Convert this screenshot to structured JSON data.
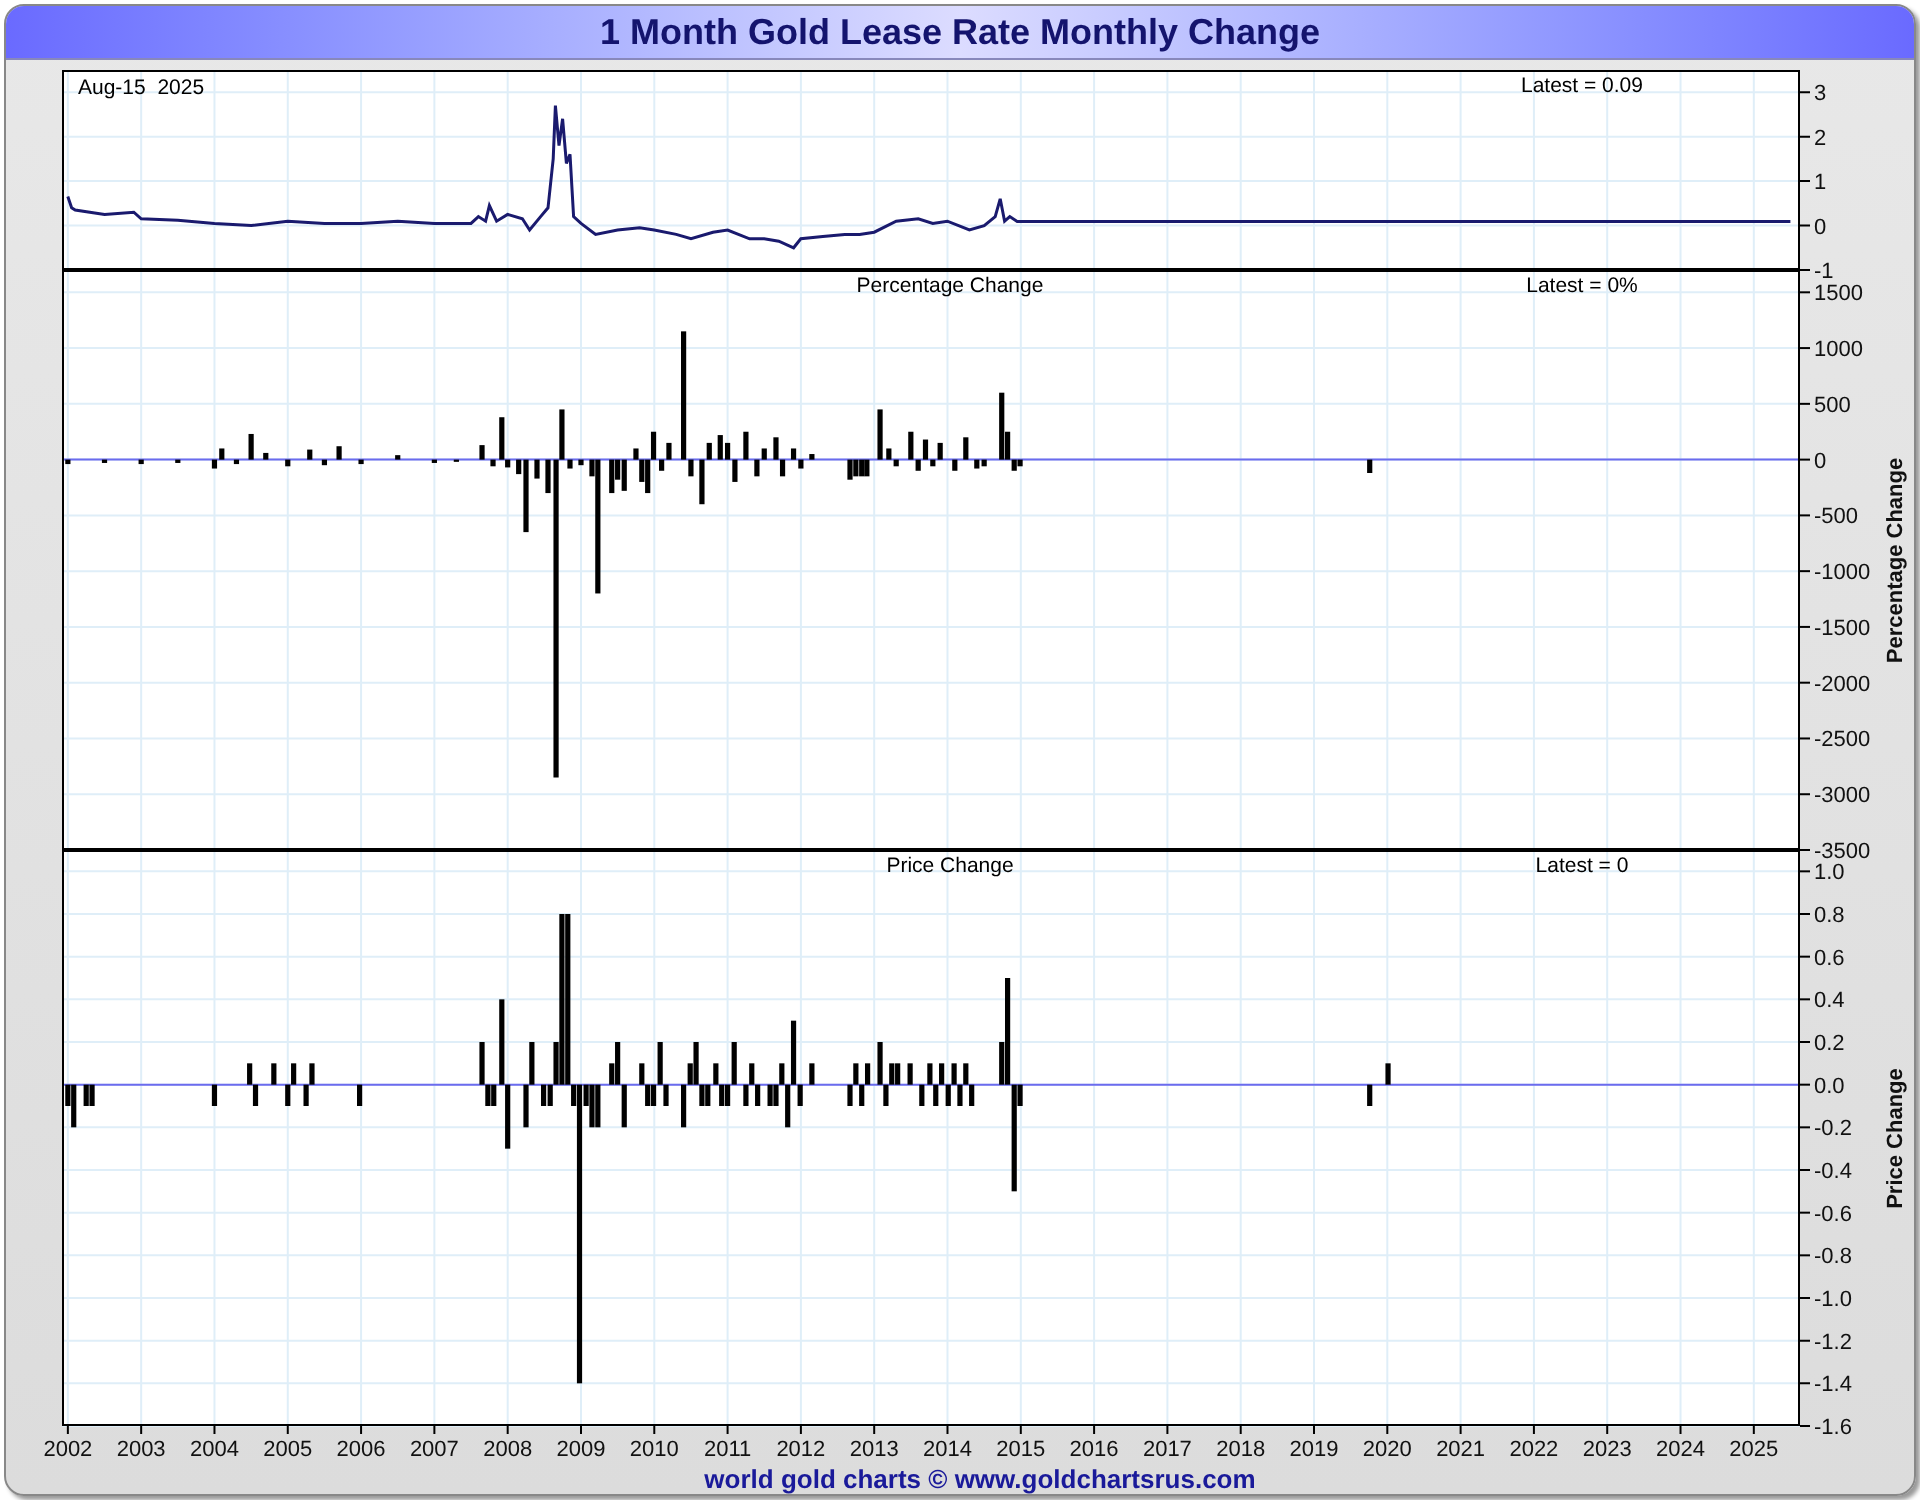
{
  "title": "1 Month Gold Lease Rate Monthly Change",
  "panels": [
    {
      "date_label": "Aug-15  2025",
      "latest": "Latest = 0.09",
      "chart_data": {
        "type": "line",
        "x": [
          2002.0,
          2002.05,
          2002.1,
          2002.3,
          2002.5,
          2002.9,
          2003.0,
          2003.5,
          2004.0,
          2004.5,
          2005.0,
          2005.5,
          2006.0,
          2006.5,
          2007.0,
          2007.5,
          2007.6,
          2007.7,
          2007.75,
          2007.85,
          2008.0,
          2008.2,
          2008.3,
          2008.45,
          2008.55,
          2008.62,
          2008.65,
          2008.7,
          2008.75,
          2008.8,
          2008.85,
          2008.9,
          2009.0,
          2009.2,
          2009.5,
          2009.8,
          2010.0,
          2010.3,
          2010.5,
          2010.8,
          2011.0,
          2011.3,
          2011.5,
          2011.7,
          2011.9,
          2012.0,
          2012.3,
          2012.6,
          2012.8,
          2013.0,
          2013.3,
          2013.6,
          2013.8,
          2014.0,
          2014.3,
          2014.5,
          2014.65,
          2014.72,
          2014.78,
          2014.85,
          2014.95,
          2015.0,
          2025.5
        ],
        "series": [
          {
            "color": "#1a1a6e",
            "values": [
              0.65,
              0.4,
              0.35,
              0.3,
              0.25,
              0.3,
              0.15,
              0.12,
              0.05,
              0.0,
              0.1,
              0.05,
              0.05,
              0.1,
              0.05,
              0.05,
              0.2,
              0.1,
              0.45,
              0.1,
              0.25,
              0.15,
              -0.1,
              0.2,
              0.4,
              1.5,
              2.7,
              1.8,
              2.4,
              1.4,
              1.6,
              0.2,
              0.05,
              -0.2,
              -0.1,
              -0.05,
              -0.1,
              -0.2,
              -0.3,
              -0.15,
              -0.1,
              -0.3,
              -0.3,
              -0.35,
              -0.5,
              -0.3,
              -0.25,
              -0.2,
              -0.2,
              -0.15,
              0.1,
              0.15,
              0.05,
              0.1,
              -0.1,
              0.0,
              0.2,
              0.6,
              0.1,
              0.2,
              0.09,
              0.09,
              0.09
            ]
          }
        ],
        "xlim": [
          2001.92,
          2025.63
        ],
        "ylim": [
          -1,
          3.5
        ],
        "grid": true,
        "yticks": [
          -1,
          0,
          1,
          2,
          3
        ]
      }
    },
    {
      "latest": "Latest = 0%",
      "chart_data": {
        "type": "bar",
        "title": "Percentage Change",
        "ylabel": "Percentage Change",
        "x": [
          2002.0,
          2002.5,
          2003.0,
          2003.5,
          2004.0,
          2004.1,
          2004.3,
          2004.5,
          2004.7,
          2005.0,
          2005.3,
          2005.5,
          2005.7,
          2006.0,
          2006.5,
          2007.0,
          2007.3,
          2007.65,
          2007.8,
          2007.92,
          2008.0,
          2008.15,
          2008.25,
          2008.4,
          2008.55,
          2008.66,
          2008.74,
          2008.85,
          2009.0,
          2009.15,
          2009.23,
          2009.42,
          2009.5,
          2009.59,
          2009.75,
          2009.83,
          2009.91,
          2009.99,
          2010.1,
          2010.2,
          2010.4,
          2010.5,
          2010.65,
          2010.75,
          2010.9,
          2011.0,
          2011.1,
          2011.25,
          2011.4,
          2011.5,
          2011.66,
          2011.75,
          2011.9,
          2012.0,
          2012.15,
          2012.67,
          2012.75,
          2012.83,
          2012.9,
          2013.08,
          2013.2,
          2013.3,
          2013.5,
          2013.6,
          2013.7,
          2013.8,
          2013.9,
          2014.1,
          2014.25,
          2014.4,
          2014.5,
          2014.74,
          2014.82,
          2014.91,
          2014.99,
          2019.76
        ],
        "values": [
          -40,
          -30,
          -40,
          -30,
          -80,
          100,
          -40,
          230,
          60,
          -60,
          90,
          -50,
          120,
          -40,
          40,
          -30,
          -20,
          130,
          -60,
          380,
          -70,
          -130,
          -650,
          -170,
          -300,
          -2850,
          450,
          -80,
          -50,
          -150,
          -1200,
          -300,
          -180,
          -280,
          100,
          -200,
          -300,
          250,
          -100,
          150,
          1150,
          -150,
          -400,
          150,
          220,
          150,
          -200,
          250,
          -150,
          100,
          200,
          -150,
          100,
          -80,
          50,
          -180,
          -150,
          -150,
          -150,
          450,
          100,
          -60,
          250,
          -100,
          180,
          -60,
          150,
          -100,
          200,
          -80,
          -60,
          600,
          250,
          -100,
          -60,
          -120
        ],
        "xlim": [
          2001.92,
          2025.63
        ],
        "ylim": [
          -3500,
          1700
        ],
        "grid": true,
        "ref_lines": [
          {
            "axis": "y",
            "value": 0,
            "color": "#6b6bee"
          }
        ],
        "yticks": [
          -3500,
          -3000,
          -2500,
          -2000,
          -1500,
          -1000,
          -500,
          0,
          500,
          1000,
          1500
        ]
      }
    },
    {
      "latest": "Latest = 0",
      "chart_data": {
        "type": "bar",
        "title": "Price Change",
        "ylabel": "Price Change",
        "x": [
          2002.0,
          2002.08,
          2002.25,
          2002.33,
          2004.0,
          2004.48,
          2004.56,
          2004.81,
          2005.0,
          2005.08,
          2005.25,
          2005.33,
          2005.98,
          2007.65,
          2007.73,
          2007.81,
          2007.92,
          2008.0,
          2008.25,
          2008.33,
          2008.49,
          2008.58,
          2008.66,
          2008.74,
          2008.82,
          2008.9,
          2008.98,
          2009.07,
          2009.15,
          2009.23,
          2009.42,
          2009.5,
          2009.59,
          2009.83,
          2009.91,
          2009.99,
          2010.08,
          2010.16,
          2010.4,
          2010.49,
          2010.57,
          2010.65,
          2010.73,
          2010.84,
          2010.92,
          2011.0,
          2011.09,
          2011.25,
          2011.33,
          2011.41,
          2011.58,
          2011.66,
          2011.74,
          2011.82,
          2011.9,
          2011.99,
          2012.15,
          2012.67,
          2012.75,
          2012.83,
          2012.91,
          2013.08,
          2013.16,
          2013.24,
          2013.32,
          2013.49,
          2013.65,
          2013.76,
          2013.84,
          2013.92,
          2014.01,
          2014.09,
          2014.17,
          2014.25,
          2014.33,
          2014.74,
          2014.82,
          2014.91,
          2014.99,
          2019.76,
          2020.01
        ],
        "values": [
          -0.1,
          -0.2,
          -0.1,
          -0.1,
          -0.1,
          0.1,
          -0.1,
          0.1,
          -0.1,
          0.1,
          -0.1,
          0.1,
          -0.1,
          0.2,
          -0.1,
          -0.1,
          0.4,
          -0.3,
          -0.2,
          0.2,
          -0.1,
          -0.1,
          0.2,
          0.8,
          0.8,
          -0.1,
          -1.4,
          -0.1,
          -0.2,
          -0.2,
          0.1,
          0.2,
          -0.2,
          0.1,
          -0.1,
          -0.1,
          0.2,
          -0.1,
          -0.2,
          0.1,
          0.2,
          -0.1,
          -0.1,
          0.1,
          -0.1,
          -0.1,
          0.2,
          -0.1,
          0.1,
          -0.1,
          -0.1,
          -0.1,
          0.1,
          -0.2,
          0.3,
          -0.1,
          0.1,
          -0.1,
          0.1,
          -0.1,
          0.1,
          0.2,
          -0.1,
          0.1,
          0.1,
          0.1,
          -0.1,
          0.1,
          -0.1,
          0.1,
          -0.1,
          0.1,
          -0.1,
          0.1,
          -0.1,
          0.2,
          0.5,
          -0.5,
          -0.1,
          -0.1,
          0.1
        ],
        "xlim": [
          2001.92,
          2025.63
        ],
        "ylim": [
          -1.6,
          1.1
        ],
        "grid": true,
        "ref_lines": [
          {
            "axis": "y",
            "value": 0,
            "color": "#6b6bee"
          }
        ],
        "yticks": [
          -1.6,
          -1.4,
          -1.2,
          {
            "value": -1,
            "label": "-1.0"
          },
          -0.8,
          -0.6,
          -0.4,
          -0.2,
          {
            "value": 0,
            "label": "0.0"
          },
          0.2,
          0.4,
          0.6,
          0.8,
          {
            "value": 1,
            "label": "1.0"
          }
        ],
        "xticks": [
          2002,
          2003,
          2004,
          2005,
          2006,
          2007,
          2008,
          2009,
          2010,
          2011,
          2012,
          2013,
          2014,
          2015,
          2016,
          2017,
          2018,
          2019,
          2020,
          2021,
          2022,
          2023,
          2024,
          2025
        ]
      }
    }
  ],
  "footer": "world gold charts © www.goldchartsrus.com"
}
